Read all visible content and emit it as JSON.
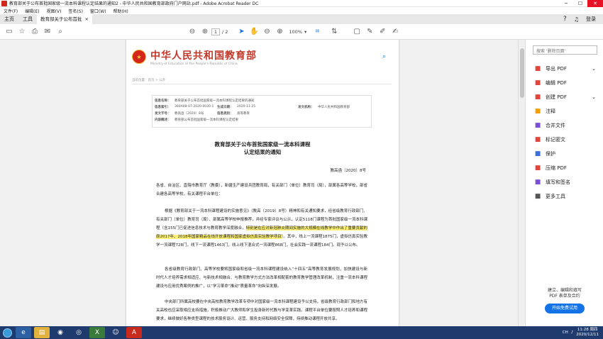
{
  "window": {
    "title": "教育部关于公布首批国家级一流本科课程认定结果的通知2 - 中华人民共和国教育部政府门户网站.pdf - Adobe Acrobat Reader DC"
  },
  "menu": [
    "文件(F)",
    "编辑(E)",
    "视图(V)",
    "签名(S)",
    "窗口(W)",
    "帮助(H)"
  ],
  "tabs": {
    "home": "主页",
    "tools": "工具",
    "doc": "教育部关于公布首批国家级一流本科课程认定结果的通知2 - 中华人民共和国教育部政府门户网站.pdf",
    "doc_short": "教育部关于公布首批国...",
    "close": "×",
    "login": "登录"
  },
  "toolbar": {
    "page_current": "1",
    "page_total": "/ 2",
    "zoom": "100%"
  },
  "right_panel": {
    "search_placeholder": "搜索 '删除页面'",
    "items": [
      {
        "label": "导出 PDF",
        "icon": "export-pdf-icon",
        "color": "#e0463c",
        "chev": "⌄"
      },
      {
        "label": "编辑 PDF",
        "icon": "edit-pdf-icon",
        "color": "#e0463c"
      },
      {
        "label": "创建 PDF",
        "icon": "create-pdf-icon",
        "color": "#e0463c",
        "chev": "⌄"
      },
      {
        "label": "注释",
        "icon": "comment-icon",
        "color": "#f2a100"
      },
      {
        "label": "合并文件",
        "icon": "combine-icon",
        "color": "#7b4fd4"
      },
      {
        "label": "标记密文",
        "icon": "redact-icon",
        "color": "#e0463c"
      },
      {
        "label": "保护",
        "icon": "protect-icon",
        "color": "#3d6fd8"
      },
      {
        "label": "压缩 PDF",
        "icon": "compress-icon",
        "color": "#e0463c"
      },
      {
        "label": "填写和签名",
        "icon": "fill-sign-icon",
        "color": "#7b4fd4"
      },
      {
        "label": "更多工具",
        "icon": "more-tools-icon",
        "color": "#555555"
      }
    ],
    "promo_line1": "建立、编辑和填写",
    "promo_line2": "PDF 表单及合约",
    "promo_button": "开始免费试用"
  },
  "page": {
    "site_name": "中华人民共和国教育部",
    "site_sub": "Ministry of Education of the People's Republic of China",
    "breadcrumb": "当前位置：首页 > 公开",
    "meta": [
      {
        "k": "信息名称：",
        "v": "教育部关于公布首批国家级一流本科课程认定结果的通知",
        "k2": "",
        "v2": ""
      },
      {
        "k": "信息索引：",
        "v": "360A08-07-2020-0030-1",
        "k2": "生成日期：",
        "v2": "2020-11-25"
      },
      {
        "k": "发文机构：",
        "v": "中华人民共和国教育部",
        "k2": "",
        "v2": ""
      },
      {
        "k": "发文字号：",
        "v": "教高函〔2020〕8号",
        "k2": "信息类别：",
        "v2": "高等教育"
      },
      {
        "k": "内容概述：",
        "v": "教育部公布首批国家级一流本科课程认定结果",
        "k2": "",
        "v2": ""
      }
    ],
    "doc_title_1": "教育部关于公布首批国家级一流本科课程",
    "doc_title_2": "认定结果的通知",
    "doc_no": "教高函〔2020〕8号",
    "p1": "各省、自治区、直辖市教育厅（教委），新疆生产建设兵团教育局，有关部门（单位）教育司（局），部属各高等学校，部省合建各高等学校，有关课程平台单位：",
    "p2a": "根据《教育部关于一流本科课程建设的实施意见》（教高〔2019〕8号）精神和有关通知要求，经省级教育行政部门、有关部门（单位）教育司（局）、部属高等学校申报推荐，并经专家评议与公示，认定5118门课程为首批国家级一流本科课程（含155门已促进信息技术与教育教学深度融合，",
    "p2b": "特别是在应对新冠肺炎期间实施的大规模在线教学中作出了重要贡献的原2017年、2018年国家精品在线开放课程和国家虚拟仿真实验教学项目",
    "p2c": "）。其中，线上一流课程1875门，虚拟仿真实验教学一流课程728门，线下一流课程1463门，线上线下混合式一流课程868门，社会实践一流课程184门。现予以公布。",
    "p3": "各省级教育行政部门、高等学校要将国家级和省级一流本科课程建设纳入“十四五”高等教育发展规划，加快建设与新时代人才培养需求相适应、与新技术相融合、与教育教学方式方法改革相配套的教育教学管理改革机制，注重一流本科课程建设与应用优秀案例的推广，以“学习革命”推动“质量革命”向纵深发展。",
    "p4": "中央部门所属高校要在中央高校教育教学改革专项中对国家级一流本科课程建设予以支持，省级教育行政部门和地方有关高校也应采取相应支持措施，积极推动广大教师和学生投身新时代教与学变革实践。课程平台单位要按照人才培养和课程要求，继续做好各种类型课程的技术服务设计、运营、服务支持和网络安全保障，持续推动课程开放共享。"
  },
  "taskbar": {
    "time": "11:28 周四",
    "date": "2020/12/11",
    "lang": "CH"
  }
}
